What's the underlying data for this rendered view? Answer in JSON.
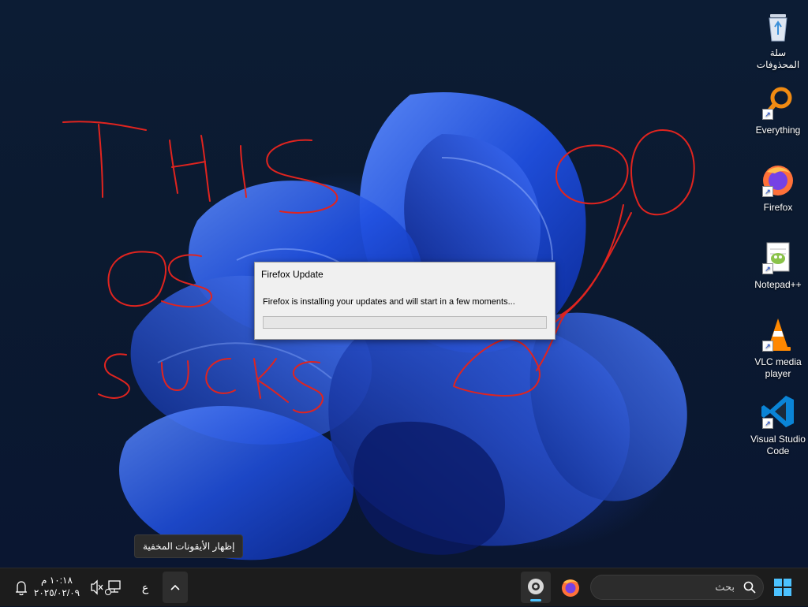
{
  "desktop": {
    "icons": [
      {
        "key": "recycle",
        "label": "سلة المحذوفات"
      },
      {
        "key": "everything",
        "label": "Everything"
      },
      {
        "key": "firefox",
        "label": "Firefox"
      },
      {
        "key": "notepadpp",
        "label": "Notepad++"
      },
      {
        "key": "vlc",
        "label": "VLC media player"
      },
      {
        "key": "vscode",
        "label": "Visual Studio Code"
      }
    ],
    "scribble_text": "THIS OS SUCKS",
    "scribble_color": "#e0241f"
  },
  "dialog": {
    "title": "Firefox Update",
    "message": "Firefox is installing your updates and will start in a few moments...",
    "progress": 0
  },
  "tooltip": {
    "text": "إظهار الأيقونات المخفية"
  },
  "taskbar": {
    "search_placeholder": "بحث",
    "lang_indicator": "ع",
    "clock_time": "١٠:١٨ م",
    "clock_date": "٢٠٢٥/٠٢/٠٩",
    "accent": "#4cc2ff"
  }
}
